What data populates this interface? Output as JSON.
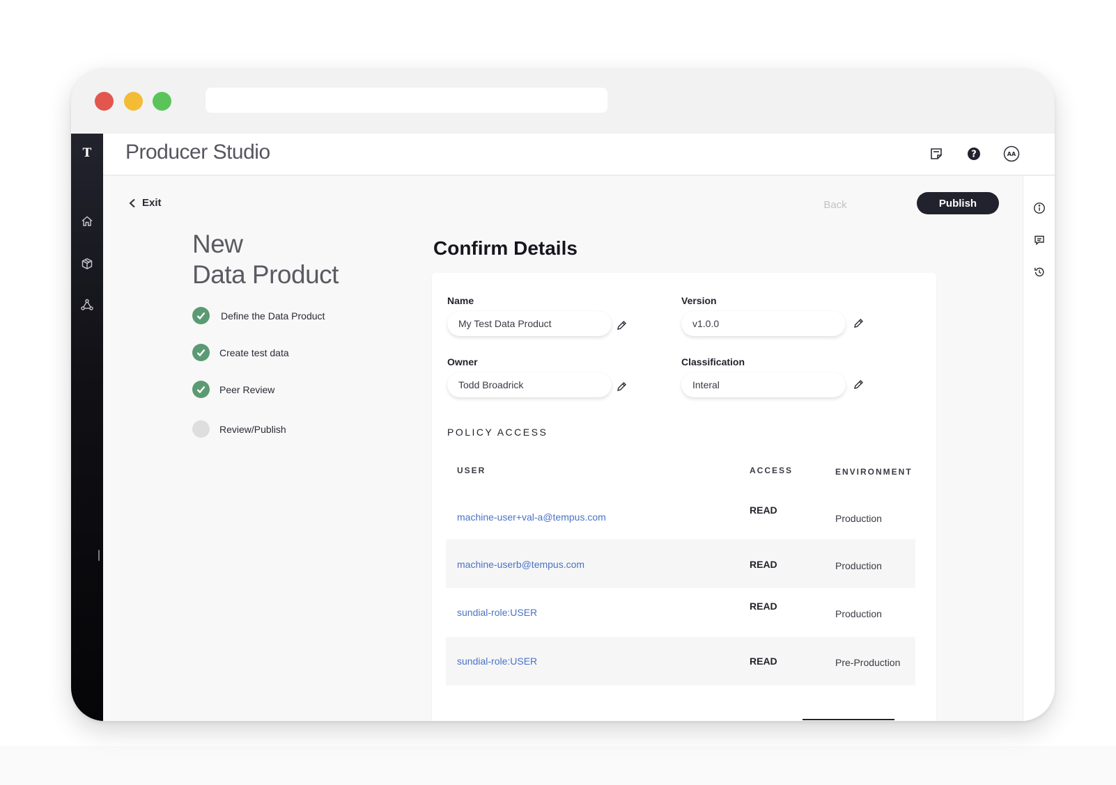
{
  "app": {
    "title": "Producer Studio",
    "logo": "T"
  },
  "icons": {
    "nav": [
      "home-icon",
      "box-icon",
      "network-icon"
    ],
    "header": [
      "notes-icon",
      "help-icon",
      "avatar"
    ],
    "rail": [
      "info-icon",
      "comment-icon",
      "history-icon"
    ]
  },
  "user": {
    "initials": "AA"
  },
  "toolbar": {
    "exit_label": "Exit",
    "back_label": "Back",
    "publish_label": "Publish"
  },
  "wizard": {
    "heading_line1": "New",
    "heading_line2": "Data Product",
    "steps": [
      {
        "label": "Define the Data Product",
        "status": "done"
      },
      {
        "label": "Create test data",
        "status": "done"
      },
      {
        "label": "Peer Review",
        "status": "done"
      },
      {
        "label": "Review/Publish",
        "status": "pending"
      }
    ]
  },
  "details": {
    "title": "Confirm Details",
    "fields": {
      "name": {
        "label": "Name",
        "value": "My Test Data Product"
      },
      "version": {
        "label": "Version",
        "value": "v1.0.0"
      },
      "owner": {
        "label": "Owner",
        "value": "Todd Broadrick"
      },
      "classification": {
        "label": "Classification",
        "value": "Interal"
      }
    },
    "policy": {
      "title": "POLICY ACCESS",
      "columns": [
        "USER",
        "ACCESS",
        "ENVIRONMENT"
      ],
      "rows": [
        {
          "user": "machine-user+val-a@tempus.com",
          "access": "READ",
          "environment": "Production"
        },
        {
          "user": "machine-userb@tempus.com",
          "access": "READ",
          "environment": "Production"
        },
        {
          "user": "sundial-role:USER",
          "access": "READ",
          "environment": "Production"
        },
        {
          "user": "sundial-role:USER",
          "access": "READ",
          "environment": "Pre-Production"
        }
      ]
    }
  },
  "colors": {
    "primary": "#22222e",
    "success": "#5b9a72",
    "link": "#4a72c6",
    "pending": "#dedede"
  }
}
